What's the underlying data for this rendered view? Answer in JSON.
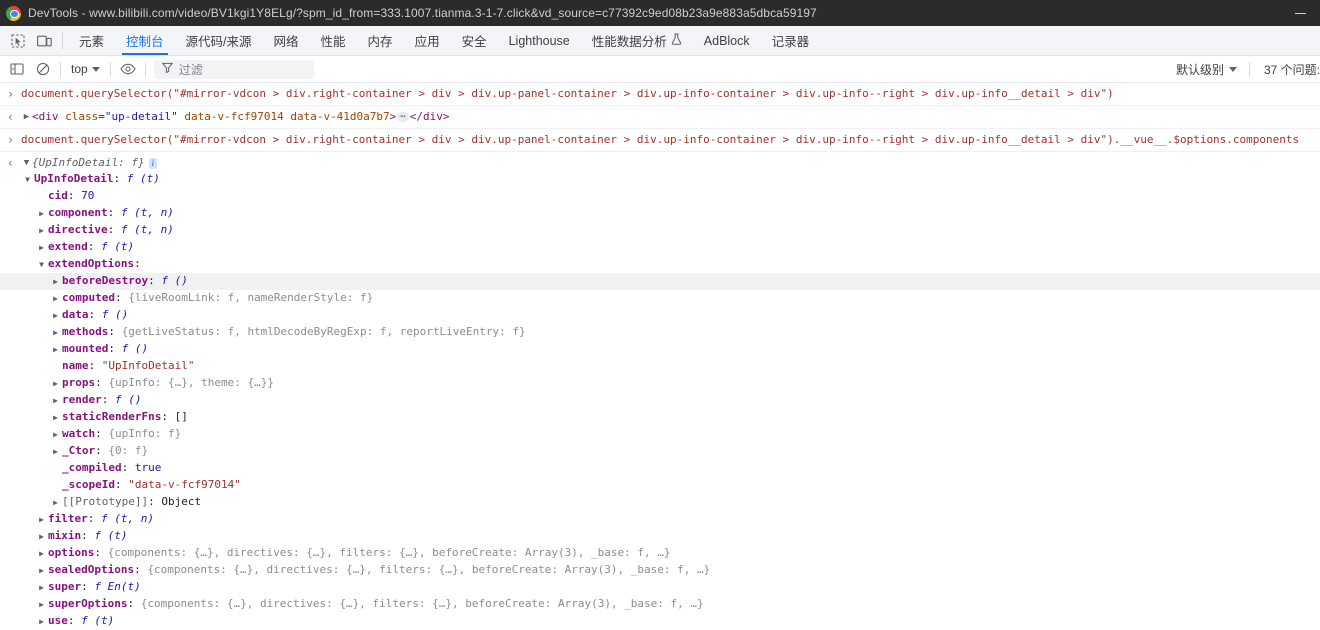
{
  "window": {
    "title": "DevTools - www.bilibili.com/video/BV1kgi1Y8ELg/?spm_id_from=333.1007.tianma.3-1-7.click&vd_source=c77392c9ed08b23a9e883a5dbca59197",
    "minimize_label": "—"
  },
  "tabbar": {
    "inspect_icon": "inspect-element-icon",
    "device_icon": "device-toolbar-icon",
    "tabs": [
      {
        "label": "元素",
        "selected": false
      },
      {
        "label": "控制台",
        "selected": true
      },
      {
        "label": "源代码/来源",
        "selected": false
      },
      {
        "label": "网络",
        "selected": false
      },
      {
        "label": "性能",
        "selected": false
      },
      {
        "label": "内存",
        "selected": false
      },
      {
        "label": "应用",
        "selected": false
      },
      {
        "label": "安全",
        "selected": false
      },
      {
        "label": "Lighthouse",
        "selected": false
      },
      {
        "label": "性能数据分析",
        "selected": false,
        "icon": "flask-icon"
      },
      {
        "label": "AdBlock",
        "selected": false
      },
      {
        "label": "记录器",
        "selected": false
      }
    ]
  },
  "console_toolbar": {
    "sidebar_icon": "console-sidebar-icon",
    "clear_icon": "clear-console-icon",
    "context": "top",
    "eye_icon": "live-expression-eye-icon",
    "filter_icon": "filter-funnel-icon",
    "filter_placeholder": "过滤",
    "level": "默认级别",
    "issues": "37 个问题:"
  },
  "messages": [
    {
      "type": "input",
      "gutter": "›",
      "text": "document.querySelector(\"#mirror-vdcon > div.right-container > div > div.up-panel-container > div.up-info-container > div.up-info--right > div.up-info__detail > div\")"
    },
    {
      "type": "output",
      "gutter": "‹",
      "kind": "element",
      "tag_open": "<div",
      "attr1_name": "class",
      "attr1_value": "\"up-detail\"",
      "attr2": "data-v-fcf97014",
      "attr3": "data-v-41d0a7b7",
      "gt": ">",
      "badge": "⋯",
      "tag_close": "</div>"
    },
    {
      "type": "input",
      "gutter": "›",
      "text": "document.querySelector(\"#mirror-vdcon > div.right-container > div > div.up-panel-container > div.up-info-container > div.up-info--right > div.up-info__detail > div\").__vue__.$options.components"
    },
    {
      "type": "output",
      "gutter": "‹",
      "kind": "object",
      "summary": "{UpInfoDetail: f}",
      "info_badge": "i"
    }
  ],
  "tree": [
    {
      "indent": 0,
      "arrow": "▼",
      "key": "UpInfoDetail",
      "sep": ":",
      "value": "f (t)",
      "vtype": "fn"
    },
    {
      "indent": 1,
      "arrow": "",
      "key": "cid",
      "sep": ":",
      "value": "70",
      "vtype": "num"
    },
    {
      "indent": 1,
      "arrow": "▶",
      "key": "component",
      "sep": ":",
      "value": "f (t, n)",
      "vtype": "fn"
    },
    {
      "indent": 1,
      "arrow": "▶",
      "key": "directive",
      "sep": ":",
      "value": "f (t, n)",
      "vtype": "fn"
    },
    {
      "indent": 1,
      "arrow": "▶",
      "key": "extend",
      "sep": ":",
      "value": "f (t)",
      "vtype": "fn"
    },
    {
      "indent": 1,
      "arrow": "▼",
      "key": "extendOptions",
      "sep": ":",
      "value": "",
      "vtype": "none"
    },
    {
      "indent": 2,
      "arrow": "▶",
      "key": "beforeDestroy",
      "sep": ":",
      "value": "f ()",
      "vtype": "fn",
      "highlight": true
    },
    {
      "indent": 2,
      "arrow": "▶",
      "key": "computed",
      "sep": ":",
      "value": "{liveRoomLink: f, nameRenderStyle: f}",
      "vtype": "preview"
    },
    {
      "indent": 2,
      "arrow": "▶",
      "key": "data",
      "sep": ":",
      "value": "f ()",
      "vtype": "fn"
    },
    {
      "indent": 2,
      "arrow": "▶",
      "key": "methods",
      "sep": ":",
      "value": "{getLiveStatus: f, htmlDecodeByRegExp: f, reportLiveEntry: f}",
      "vtype": "preview"
    },
    {
      "indent": 2,
      "arrow": "▶",
      "key": "mounted",
      "sep": ":",
      "value": "f ()",
      "vtype": "fn"
    },
    {
      "indent": 2,
      "arrow": "",
      "key": "name",
      "sep": ":",
      "value": "\"UpInfoDetail\"",
      "vtype": "str"
    },
    {
      "indent": 2,
      "arrow": "▶",
      "key": "props",
      "sep": ":",
      "value": "{upInfo: {…}, theme: {…}}",
      "vtype": "preview"
    },
    {
      "indent": 2,
      "arrow": "▶",
      "key": "render",
      "sep": ":",
      "value": "f ()",
      "vtype": "fn"
    },
    {
      "indent": 2,
      "arrow": "▶",
      "key": "staticRenderFns",
      "sep": ":",
      "value": "[]",
      "vtype": "plain"
    },
    {
      "indent": 2,
      "arrow": "▶",
      "key": "watch",
      "sep": ":",
      "value": "{upInfo: f}",
      "vtype": "preview"
    },
    {
      "indent": 2,
      "arrow": "▶",
      "key": "_Ctor",
      "sep": ":",
      "value": "{0: f}",
      "vtype": "preview"
    },
    {
      "indent": 2,
      "arrow": "",
      "key": "_compiled",
      "sep": ":",
      "value": "true",
      "vtype": "bool"
    },
    {
      "indent": 2,
      "arrow": "",
      "key": "_scopeId",
      "sep": ":",
      "value": "\"data-v-fcf97014\"",
      "vtype": "str"
    },
    {
      "indent": 2,
      "arrow": "▶",
      "key": "[[Prototype]]",
      "sep": ":",
      "value": "Object",
      "vtype": "plain",
      "proto": true
    },
    {
      "indent": 1,
      "arrow": "▶",
      "key": "filter",
      "sep": ":",
      "value": "f (t, n)",
      "vtype": "fn"
    },
    {
      "indent": 1,
      "arrow": "▶",
      "key": "mixin",
      "sep": ":",
      "value": "f (t)",
      "vtype": "fn"
    },
    {
      "indent": 1,
      "arrow": "▶",
      "key": "options",
      "sep": ":",
      "value": "{components: {…}, directives: {…}, filters: {…}, beforeCreate: Array(3), _base: f,  …}",
      "vtype": "preview"
    },
    {
      "indent": 1,
      "arrow": "▶",
      "key": "sealedOptions",
      "sep": ":",
      "value": "{components: {…}, directives: {…}, filters: {…}, beforeCreate: Array(3), _base: f,  …}",
      "vtype": "preview"
    },
    {
      "indent": 1,
      "arrow": "▶",
      "key": "super",
      "sep": ":",
      "value": "f En(t)",
      "vtype": "fn"
    },
    {
      "indent": 1,
      "arrow": "▶",
      "key": "superOptions",
      "sep": ":",
      "value": "{components: {…}, directives: {…}, filters: {…}, beforeCreate: Array(3), _base: f,  …}",
      "vtype": "preview"
    },
    {
      "indent": 1,
      "arrow": "▶",
      "key": "use",
      "sep": ":",
      "value": "f (t)",
      "vtype": "fn"
    }
  ],
  "colors": {
    "accent": "#1a73e8",
    "titlebar_bg": "#2b2b2b",
    "tabbar_bg": "#f3f5f9",
    "key": "#881280",
    "string": "#a1322e",
    "number": "#1a1aa6"
  }
}
